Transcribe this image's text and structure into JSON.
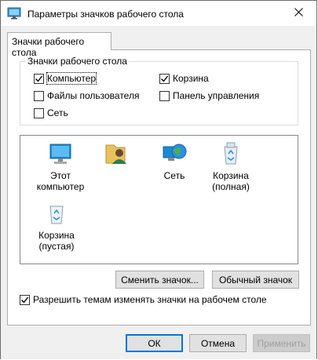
{
  "window": {
    "title": "Параметры значков рабочего стола",
    "icon": "desktop-settings-icon",
    "close_glyph": "✕"
  },
  "tab": {
    "label": "Значки рабочего стола"
  },
  "group": {
    "legend": "Значки рабочего стола",
    "checkboxes": [
      {
        "label": "Компьютер",
        "checked": true
      },
      {
        "label": "Корзина",
        "checked": true
      },
      {
        "label": "Файлы пользователя",
        "checked": false
      },
      {
        "label": "Панель управления",
        "checked": false
      },
      {
        "label": "Сеть",
        "checked": false
      }
    ]
  },
  "icons": [
    {
      "name": "this-pc-icon",
      "label_line1": "Этот",
      "label_line2": "компьютер"
    },
    {
      "name": "user-files-icon",
      "label_line1": "",
      "label_line2": ""
    },
    {
      "name": "network-icon",
      "label_line1": "Сеть",
      "label_line2": ""
    },
    {
      "name": "recycle-bin-full-icon",
      "label_line1": "Корзина",
      "label_line2": "(полная)"
    },
    {
      "name": "recycle-bin-empty-icon",
      "label_line1": "Корзина",
      "label_line2": "(пустая)"
    }
  ],
  "buttons": {
    "change_icon": "Сменить значок...",
    "restore_default": "Обычный значок",
    "ok": "ОК",
    "cancel": "Отмена",
    "apply": "Применить"
  },
  "theme_checkbox": {
    "label": "Разрешить темам изменять значки на рабочем столе",
    "checked": true
  },
  "colors": {
    "accent": "#0078d7",
    "window_bg": "#f0f0f0",
    "panel_bg": "#ffffff"
  }
}
